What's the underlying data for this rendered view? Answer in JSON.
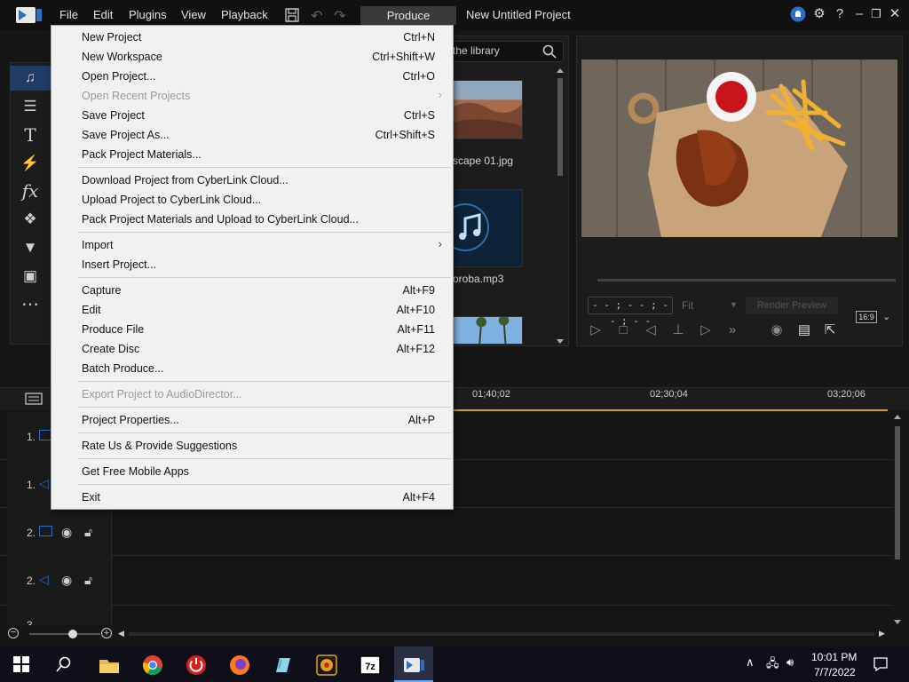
{
  "titlebar": {
    "menus": [
      "File",
      "Edit",
      "Plugins",
      "View",
      "Playback"
    ],
    "produce_label": "Produce",
    "project_title": "New Untitled Project"
  },
  "library": {
    "search_text": "the library",
    "items": [
      {
        "label": "scape 01.jpg"
      },
      {
        "label": "oroba.mp3"
      }
    ]
  },
  "preview": {
    "timecode": "- - ; - - ; - - ; - -",
    "fit_label": "Fit",
    "render_label": "Render Preview",
    "ratio_label": "16:9"
  },
  "timeline": {
    "ticks": [
      "01;40;02",
      "02;30;04",
      "03;20;06"
    ],
    "tracks": [
      {
        "label": "1.",
        "kind": "video"
      },
      {
        "label": "1.",
        "kind": "audio"
      },
      {
        "label": "2.",
        "kind": "video"
      },
      {
        "label": "2.",
        "kind": "audio"
      },
      {
        "label": "3.",
        "kind": "video"
      }
    ]
  },
  "file_menu": {
    "items": [
      {
        "label": "New Project",
        "shortcut": "Ctrl+N"
      },
      {
        "label": "New Workspace",
        "shortcut": "Ctrl+Shift+W"
      },
      {
        "label": "Open Project...",
        "shortcut": "Ctrl+O"
      },
      {
        "label": "Open Recent Projects",
        "shortcut": "",
        "disabled": true,
        "submenu": true
      },
      {
        "label": "Save Project",
        "shortcut": "Ctrl+S"
      },
      {
        "label": "Save Project As...",
        "shortcut": "Ctrl+Shift+S"
      },
      {
        "label": "Pack Project Materials...",
        "shortcut": ""
      },
      {
        "label": "Download Project from CyberLink Cloud...",
        "shortcut": ""
      },
      {
        "label": "Upload Project to CyberLink Cloud...",
        "shortcut": ""
      },
      {
        "label": "Pack Project Materials and Upload to CyberLink Cloud...",
        "shortcut": ""
      },
      {
        "label": "Import",
        "shortcut": "",
        "submenu": true
      },
      {
        "label": "Insert Project...",
        "shortcut": ""
      },
      {
        "label": "Capture",
        "shortcut": "Alt+F9"
      },
      {
        "label": "Edit",
        "shortcut": "Alt+F10"
      },
      {
        "label": "Produce File",
        "shortcut": "Alt+F11"
      },
      {
        "label": "Create Disc",
        "shortcut": "Alt+F12"
      },
      {
        "label": "Batch Produce...",
        "shortcut": ""
      },
      {
        "label": "Export Project to AudioDirector...",
        "shortcut": "",
        "disabled": true
      },
      {
        "label": "Project Properties...",
        "shortcut": "Alt+P"
      },
      {
        "label": "Rate Us & Provide Suggestions",
        "shortcut": ""
      },
      {
        "label": "Get Free Mobile Apps",
        "shortcut": ""
      },
      {
        "label": "Exit",
        "shortcut": "Alt+F4"
      }
    ]
  },
  "taskbar": {
    "icons": [
      "start-icon",
      "search-icon",
      "file-explorer-icon",
      "chrome-icon",
      "power-app-icon",
      "firefox-icon",
      "notepad-icon",
      "media-app-icon",
      "7zip-icon",
      "powerdirector-icon"
    ],
    "time": "10:01 PM",
    "date": "7/7/2022"
  },
  "colors": {
    "accent_blue": "#2a6fc9",
    "ruler_gold": "#c9a227",
    "menu_bg": "#f1f1f1"
  }
}
